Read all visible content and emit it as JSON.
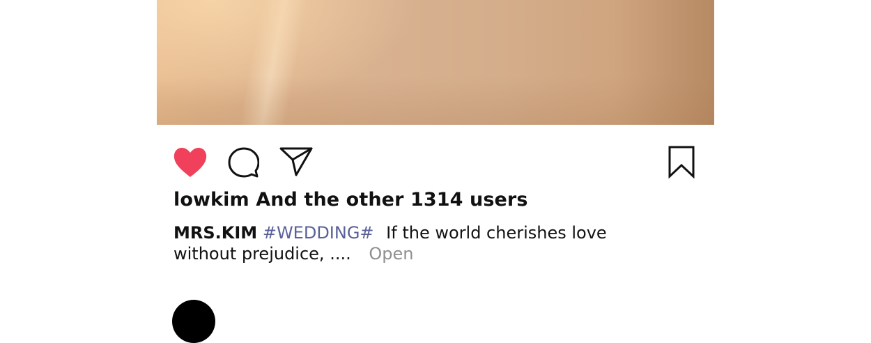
{
  "post": {
    "likes_text": "lowkim And the other 1314 users",
    "caption": {
      "username": "MRS.KIM",
      "hashtag": "#WEDDING#",
      "text": "If the world cherishes love without prejudice, ....",
      "open_label": "Open"
    }
  },
  "actions": {
    "like_color": "#f0405b",
    "icons": [
      "heart-icon",
      "comment-icon",
      "send-icon",
      "bookmark-icon"
    ]
  }
}
